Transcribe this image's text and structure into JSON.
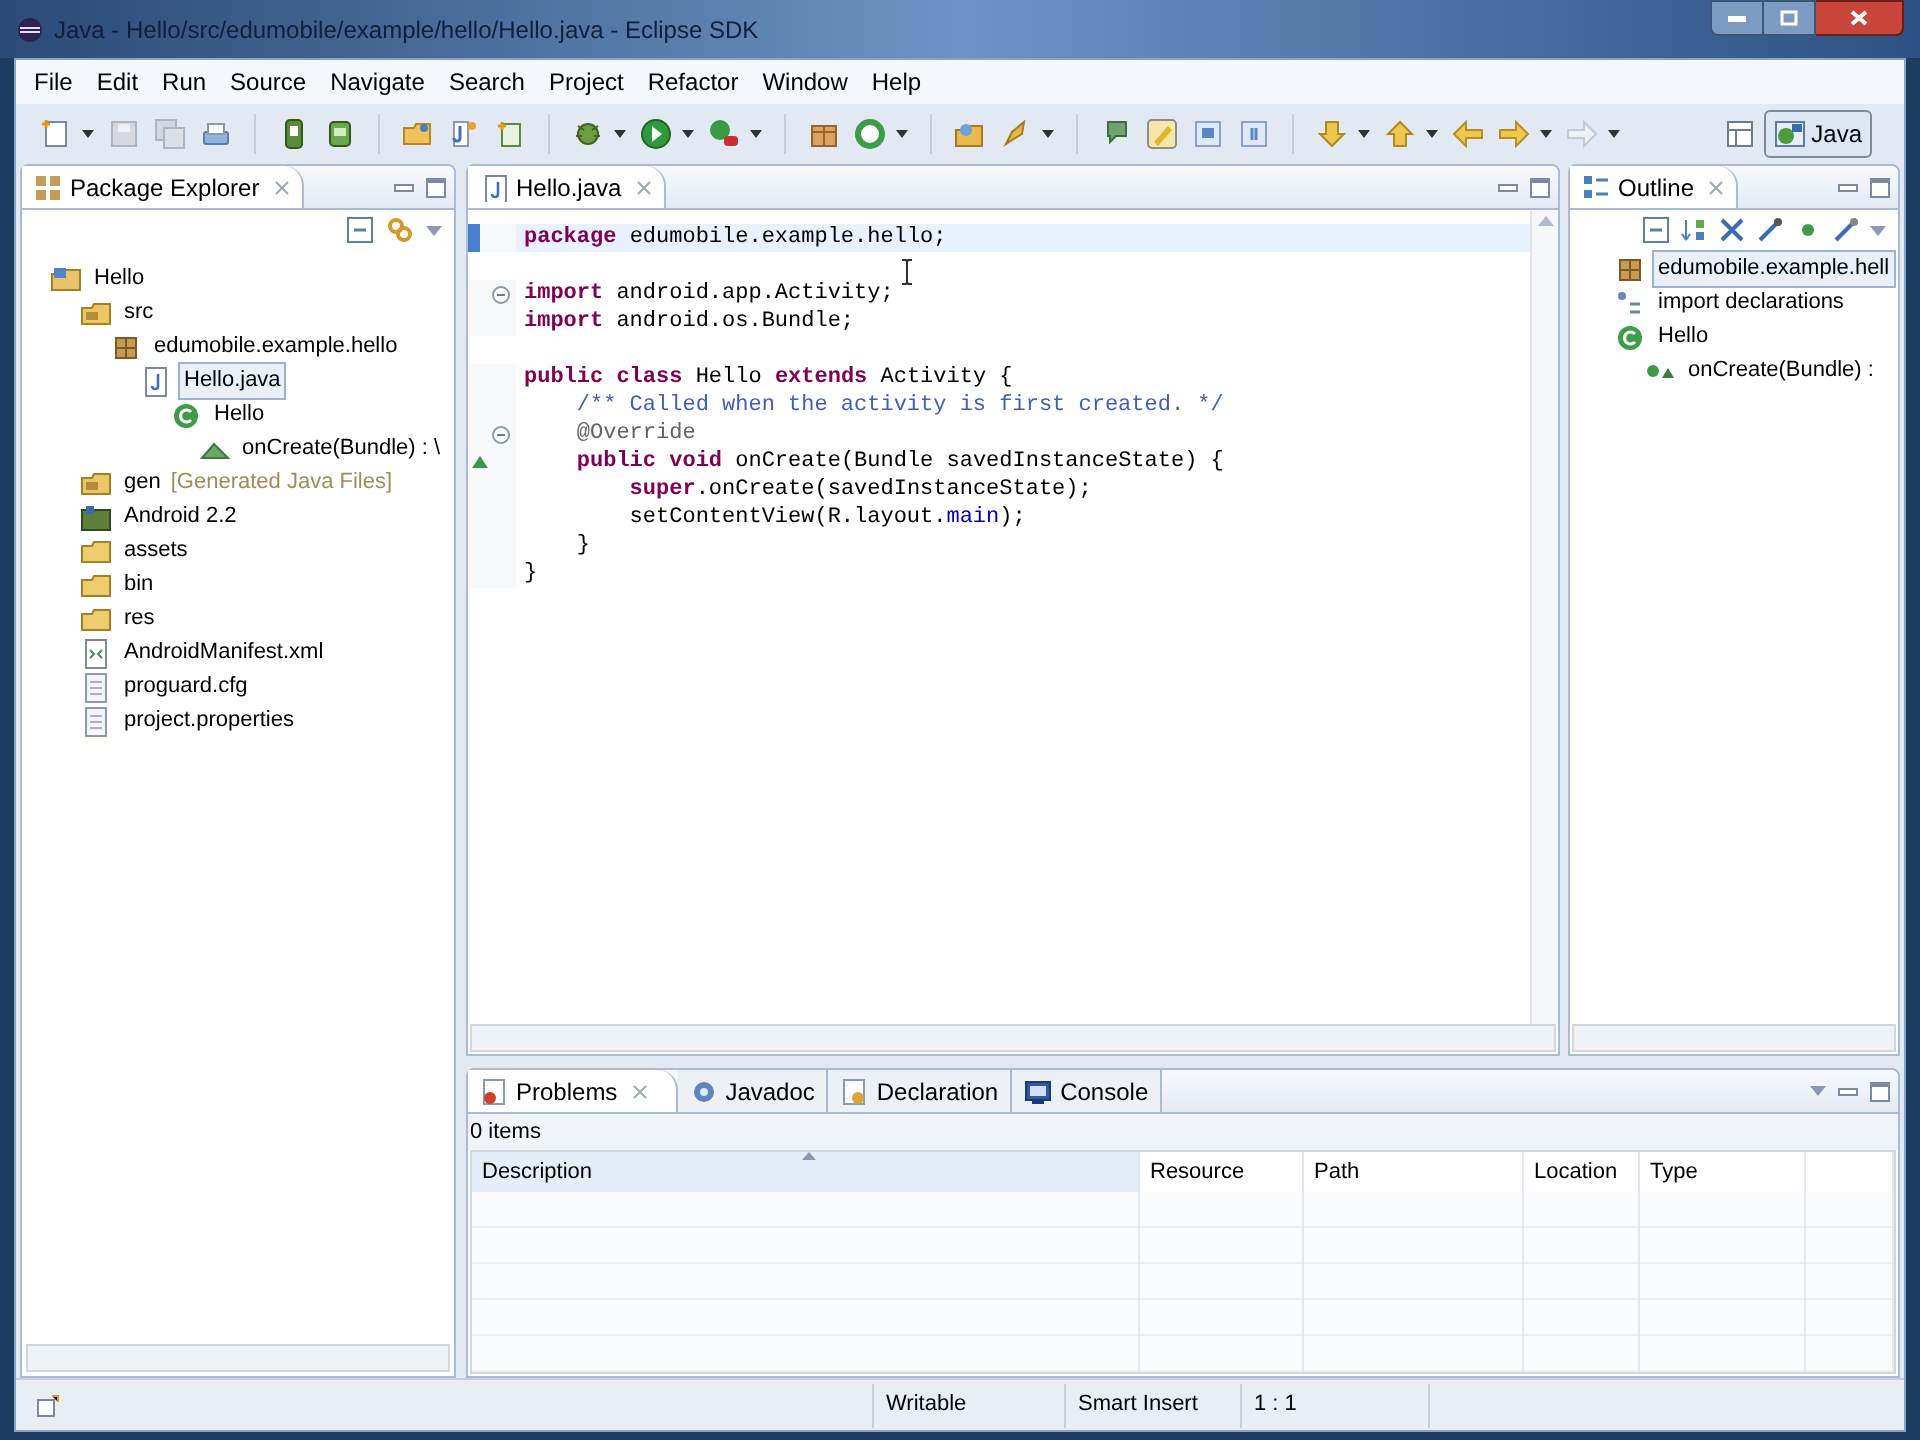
{
  "window": {
    "title": "Java - Hello/src/edumobile/example/hello/Hello.java - Eclipse SDK"
  },
  "menu": [
    "File",
    "Edit",
    "Run",
    "Source",
    "Navigate",
    "Search",
    "Project",
    "Refactor",
    "Window",
    "Help"
  ],
  "perspective": {
    "label": "Java",
    "selected": true
  },
  "package_explorer": {
    "tab": "Package Explorer",
    "tree": [
      {
        "label": "Hello",
        "kind": "project",
        "selected": false,
        "children": [
          {
            "label": "src",
            "kind": "source-folder",
            "selected": false,
            "children": [
              {
                "label": "edumobile.example.hello",
                "kind": "package",
                "selected": false,
                "children": [
                  {
                    "label": "Hello.java",
                    "kind": "java-file",
                    "selected": true,
                    "children": [
                      {
                        "label": "Hello",
                        "kind": "class",
                        "selected": false,
                        "children": [
                          {
                            "label": "onCreate(Bundle) : \\",
                            "kind": "method",
                            "selected": false
                          }
                        ]
                      }
                    ]
                  }
                ]
              }
            ]
          },
          {
            "label": "gen",
            "decoration": "[Generated Java Files]",
            "kind": "source-folder",
            "selected": false
          },
          {
            "label": "Android 2.2",
            "kind": "library",
            "selected": false
          },
          {
            "label": "assets",
            "kind": "folder",
            "selected": false
          },
          {
            "label": "bin",
            "kind": "folder",
            "selected": false
          },
          {
            "label": "res",
            "kind": "folder",
            "selected": false
          },
          {
            "label": "AndroidManifest.xml",
            "kind": "xml-file",
            "selected": false
          },
          {
            "label": "proguard.cfg",
            "kind": "file",
            "selected": false
          },
          {
            "label": "project.properties",
            "kind": "file",
            "selected": false
          }
        ]
      }
    ]
  },
  "editor": {
    "tab": "Hello.java",
    "lines": [
      {
        "kind": "code",
        "current": true,
        "fold": false,
        "override": false,
        "tokens": [
          {
            "t": "package",
            "kind": "kw"
          },
          {
            "t": " edumobile.example.hello;",
            "kind": "plain"
          }
        ]
      },
      {
        "kind": "blank"
      },
      {
        "kind": "code",
        "current": false,
        "fold": true,
        "override": false,
        "tokens": [
          {
            "t": "import",
            "kind": "kw"
          },
          {
            "t": " android.app.Activity;",
            "kind": "plain"
          }
        ]
      },
      {
        "kind": "code",
        "current": false,
        "fold": false,
        "override": false,
        "tokens": [
          {
            "t": "import",
            "kind": "kw"
          },
          {
            "t": " android.os.Bundle;",
            "kind": "plain"
          }
        ]
      },
      {
        "kind": "blank"
      },
      {
        "kind": "code",
        "current": false,
        "fold": false,
        "override": false,
        "tokens": [
          {
            "t": "public class",
            "kind": "kw"
          },
          {
            "t": " Hello ",
            "kind": "plain"
          },
          {
            "t": "extends",
            "kind": "kw"
          },
          {
            "t": " Activity {",
            "kind": "plain"
          }
        ]
      },
      {
        "kind": "code",
        "current": false,
        "fold": false,
        "override": false,
        "tokens": [
          {
            "t": "    /** Called when the activity is first created. */",
            "kind": "comment"
          }
        ]
      },
      {
        "kind": "code",
        "current": false,
        "fold": true,
        "override": false,
        "tokens": [
          {
            "t": "    @Override",
            "kind": "annotation"
          }
        ]
      },
      {
        "kind": "code",
        "current": false,
        "fold": false,
        "override": true,
        "tokens": [
          {
            "t": "    public void",
            "kind": "kw"
          },
          {
            "t": " onCreate(Bundle savedInstanceState) {",
            "kind": "plain"
          }
        ]
      },
      {
        "kind": "code",
        "current": false,
        "fold": false,
        "override": false,
        "tokens": [
          {
            "t": "        super",
            "kind": "kw"
          },
          {
            "t": ".onCreate(savedInstanceState);",
            "kind": "plain"
          }
        ]
      },
      {
        "kind": "code",
        "current": false,
        "fold": false,
        "override": false,
        "tokens": [
          {
            "t": "        setContentView(R.layout.",
            "kind": "plain"
          },
          {
            "t": "main",
            "kind": "field"
          },
          {
            "t": ");",
            "kind": "plain"
          }
        ]
      },
      {
        "kind": "code",
        "current": false,
        "fold": false,
        "override": false,
        "tokens": [
          {
            "t": "    }",
            "kind": "plain"
          }
        ]
      },
      {
        "kind": "code",
        "current": false,
        "fold": false,
        "override": false,
        "tokens": [
          {
            "t": "}",
            "kind": "plain"
          }
        ]
      }
    ]
  },
  "outline": {
    "tab": "Outline",
    "tree": [
      {
        "label": "edumobile.example.hell",
        "kind": "package",
        "selected": true
      },
      {
        "label": "import declarations",
        "kind": "imports",
        "selected": false
      },
      {
        "label": "Hello",
        "kind": "class",
        "selected": false,
        "children": [
          {
            "label": "onCreate(Bundle) :",
            "kind": "public-method",
            "selected": false
          }
        ]
      }
    ]
  },
  "bottom_panel": {
    "tabs": [
      {
        "label": "Problems",
        "kind": "problems",
        "selected": true
      },
      {
        "label": "Javadoc",
        "kind": "javadoc",
        "selected": false
      },
      {
        "label": "Declaration",
        "kind": "declaration",
        "selected": false
      },
      {
        "label": "Console",
        "kind": "console",
        "selected": false
      }
    ],
    "summary": "0 items",
    "columns": [
      "Description",
      "Resource",
      "Path",
      "Location",
      "Type"
    ]
  },
  "status_bar": [
    "Writable",
    "Smart Insert",
    "1 : 1"
  ]
}
